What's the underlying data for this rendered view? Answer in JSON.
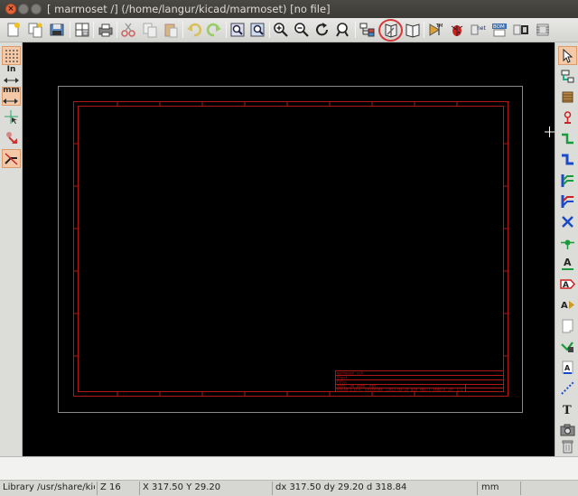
{
  "window": {
    "title": "[ marmoset /] (/home/langur/kicad/marmoset) [no file]",
    "close_glyph": "×"
  },
  "toolbar": {
    "icons": [
      "new-sheet-icon",
      "hierarchy-icon",
      "save-icon",
      "page-settings-icon",
      "print-icon",
      "cut-icon",
      "copy-icon",
      "paste-icon",
      "undo-icon",
      "redo-icon",
      "find-icon",
      "find-replace-icon",
      "zoom-in-icon",
      "zoom-out-icon",
      "zoom-redraw-icon",
      "zoom-fit-icon",
      "hierarchy-nav-icon",
      "library-editor-icon",
      "library-browser-icon",
      "annotate-icon",
      "erc-icon",
      "netlist-icon",
      "bom-icon",
      "cvpcb-icon",
      "pcbnew-icon"
    ],
    "netlist_label": "TM",
    "net_label": "net",
    "bom_label": "BOM"
  },
  "left_toolbar": {
    "grid": "grid-toggle-icon",
    "inch_label": "In",
    "mm_label": "mm",
    "cursor": "cursor-shape-icon",
    "hidden_pins": "hidden-pins-icon",
    "bus_wire": "bus-wire-orient-icon"
  },
  "right_toolbar": {
    "text_tool_label": "T",
    "label_tool_label": "A"
  },
  "title_block": {
    "row1": "marmoset.sch",
    "row2": "Sheet:",
    "row3": "File:",
    "row4": "Size: A4   Date:              Rev:",
    "row5": "KiCad E.D.A.  eeschema (2013-05-18 BZR 4017)-stable      Id: 1/1"
  },
  "status": {
    "library": "Library /usr/share/kic",
    "zoom": "Z 16",
    "abs_pos": "X 317.50  Y 29.20",
    "rel_pos": "dx 317.50  dy 29.20  d 318.84",
    "units": "mm"
  }
}
